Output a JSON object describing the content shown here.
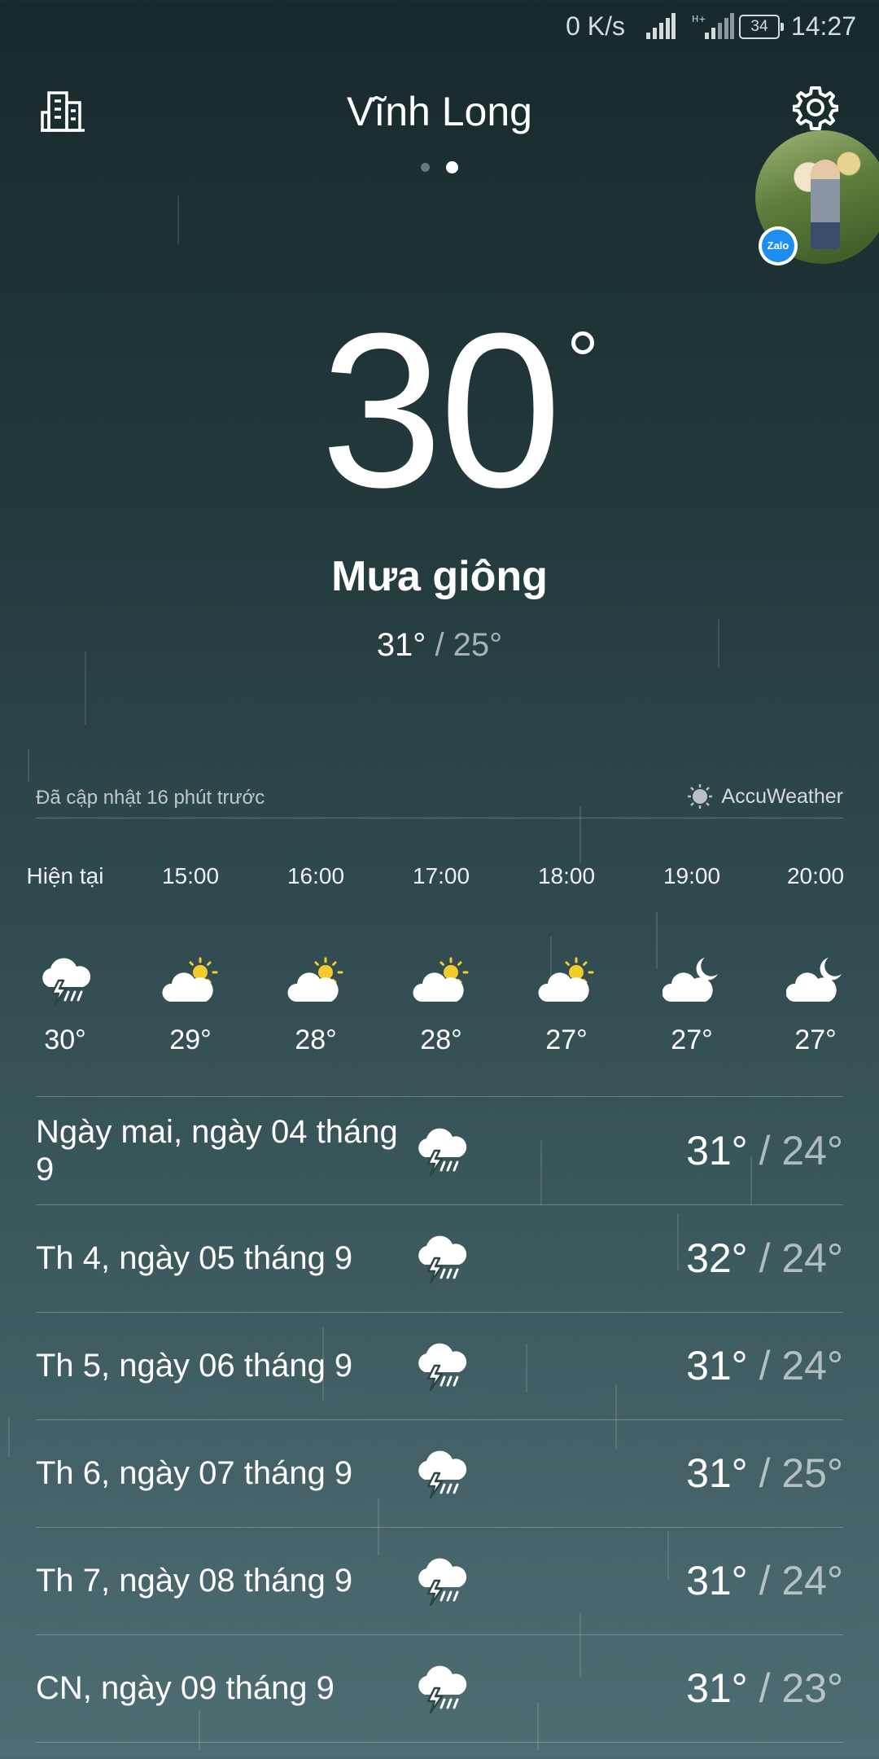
{
  "status_bar": {
    "net_speed": "0 K/s",
    "network_type": "H+",
    "battery": "34",
    "time": "14:27"
  },
  "header": {
    "city": "Vĩnh Long",
    "city_list_icon": "building-icon",
    "settings_icon": "gear-icon",
    "page_count": 2,
    "active_page": 2
  },
  "current": {
    "temperature": "30",
    "condition": "Mưa giông",
    "high": "31°",
    "low": "25°"
  },
  "updated": {
    "text": "Đã cập nhật 16 phút trước",
    "provider": "AccuWeather"
  },
  "hourly": [
    {
      "time": "Hiện tại",
      "icon": "thunderstorm-icon",
      "temp": "30°"
    },
    {
      "time": "15:00",
      "icon": "partly-sunny-icon",
      "temp": "29°"
    },
    {
      "time": "16:00",
      "icon": "partly-sunny-icon",
      "temp": "28°"
    },
    {
      "time": "17:00",
      "icon": "partly-sunny-icon",
      "temp": "28°"
    },
    {
      "time": "18:00",
      "icon": "partly-sunny-icon",
      "temp": "27°"
    },
    {
      "time": "19:00",
      "icon": "partly-cloudy-night-icon",
      "temp": "27°"
    },
    {
      "time": "20:00",
      "icon": "partly-cloudy-night-icon",
      "temp": "27°"
    }
  ],
  "daily": [
    {
      "day": "Ngày mai, ngày 04 tháng 9",
      "icon": "thunderstorm-icon",
      "high": "31°",
      "low": "24°"
    },
    {
      "day": "Th 4, ngày 05 tháng 9",
      "icon": "thunderstorm-icon",
      "high": "32°",
      "low": "24°"
    },
    {
      "day": "Th 5, ngày 06 tháng 9",
      "icon": "thunderstorm-icon",
      "high": "31°",
      "low": "24°"
    },
    {
      "day": "Th 6, ngày 07 tháng 9",
      "icon": "thunderstorm-icon",
      "high": "31°",
      "low": "25°"
    },
    {
      "day": "Th 7, ngày 08 tháng 9",
      "icon": "thunderstorm-icon",
      "high": "31°",
      "low": "24°"
    },
    {
      "day": "CN, ngày 09 tháng 9",
      "icon": "thunderstorm-icon",
      "high": "31°",
      "low": "23°"
    }
  ],
  "chat_bubble": {
    "app_badge": "Zalo"
  }
}
